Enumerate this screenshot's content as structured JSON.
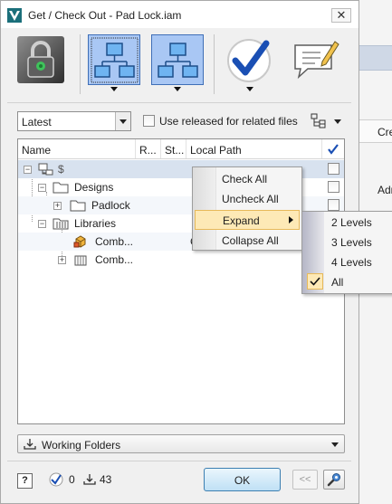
{
  "window": {
    "title": "Get / Check Out - Pad Lock.iam",
    "close_glyph": "✕",
    "app_icon": "vault-logo-icon"
  },
  "background_app": {
    "column_header": "Cre",
    "cell": "Adm"
  },
  "toolbar": {
    "buttons": [
      {
        "name": "lock-status",
        "icon": "padlock-icon",
        "selected": false,
        "has_dropdown": false
      },
      {
        "name": "include-children",
        "icon": "hierarchy-children-icon",
        "selected": true,
        "has_dropdown": true
      },
      {
        "name": "include-parents",
        "icon": "hierarchy-parents-icon",
        "selected": true,
        "has_dropdown": true
      },
      {
        "name": "check-out",
        "icon": "checkmark-icon",
        "selected": false,
        "has_dropdown": true
      },
      {
        "name": "comment",
        "icon": "speech-bubble-pencil-icon",
        "selected": false,
        "has_dropdown": false
      }
    ]
  },
  "options": {
    "revision_value": "Latest",
    "use_released_label": "Use released for related files",
    "use_released_checked": false,
    "view_icon": "tree-view-icon"
  },
  "grid": {
    "columns": {
      "name": "Name",
      "revision": "R...",
      "status": "St...",
      "local_path": "Local Path",
      "check_header_icon": "checkmark-icon"
    },
    "rows": [
      {
        "label": "$",
        "icon": "vault-root-icon",
        "expander": "−",
        "local_path": "",
        "selected": true
      },
      {
        "label": "Designs",
        "icon": "folder-icon",
        "expander": "−",
        "local_path": "",
        "selected": false
      },
      {
        "label": "Padlock",
        "icon": "folder-icon",
        "expander": "+",
        "local_path": "",
        "selected": false
      },
      {
        "label": "Libraries",
        "icon": "library-folder-icon",
        "expander": "−",
        "local_path": "",
        "selected": false
      },
      {
        "label": "Comb...",
        "icon": "assembly-icon",
        "expander": "",
        "local_path": "C",
        "selected": false
      },
      {
        "label": "Comb...",
        "icon": "part-icon",
        "expander": "+",
        "local_path": "",
        "selected": false
      }
    ]
  },
  "context_menu": {
    "items": [
      {
        "label": "Check All"
      },
      {
        "label": "Uncheck All"
      },
      {
        "label": "Expand",
        "highlighted": true,
        "has_submenu": true
      },
      {
        "label": "Collapse All"
      }
    ],
    "submenu": {
      "items": [
        {
          "label": "2 Levels",
          "checked": false
        },
        {
          "label": "3 Levels",
          "checked": false
        },
        {
          "label": "4 Levels",
          "checked": false
        },
        {
          "label": "All",
          "checked": true
        }
      ]
    }
  },
  "working_folders": {
    "label": "Working Folders",
    "icon": "download-icon"
  },
  "footer": {
    "help_label": "?",
    "checked_count": "0",
    "download_count": "43",
    "ok_label": "OK",
    "back_label": "<<",
    "settings_icon": "settings-icon"
  },
  "colors": {
    "selection": "#a9c7f4",
    "menu_highlight": "#fde9b6",
    "row_selected": "#d8e2ef"
  }
}
